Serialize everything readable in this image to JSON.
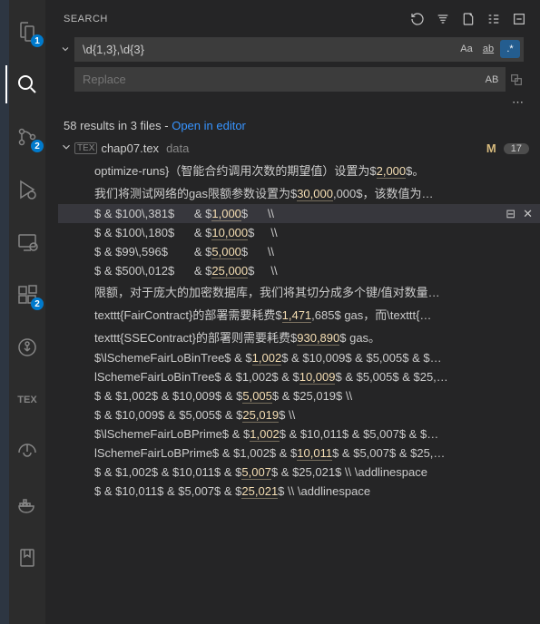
{
  "sidebar_title": "SEARCH",
  "search": {
    "query": "\\d{1,3},\\d{3}",
    "replace_placeholder": "Replace",
    "case_label": "Aa",
    "word_label": "ab",
    "regex_label": ".*",
    "preserve_case_label": "AB"
  },
  "summary": {
    "text": "58 results in 3 files - ",
    "link": "Open in editor"
  },
  "file": {
    "name": "chap07.tex",
    "folder": "data",
    "status": "M",
    "count": "17",
    "icon_label": "TEX"
  },
  "activity_badges": {
    "explorer": "1",
    "scm": "2",
    "ext": "2"
  },
  "lines": [
    {
      "pre": "optimize-runs}（智能合约调用次数的期望值）设置为$",
      "hl": "2,000",
      "post": "$。"
    },
    {
      "pre": "我们将测试网络的gas限额参数设置为$",
      "hl": "30,000",
      "post": ",000$，该数值为…"
    },
    {
      "pre": "$ & $100\\,381$      & $",
      "hl": "1,000",
      "post": "$      \\\\",
      "active": true
    },
    {
      "pre": "$ & $100\\,180$      & $",
      "hl": "10,000",
      "post": "$     \\\\"
    },
    {
      "pre": "$ & $99\\,596$        & $",
      "hl": "5,000",
      "post": "$      \\\\"
    },
    {
      "pre": "$ & $500\\,012$      & $",
      "hl": "25,000",
      "post": "$     \\\\"
    },
    {
      "pre": "限额，对于庞大的加密数据库，我们将其切分成多个键/值对数量…",
      "hl": "",
      "post": ""
    },
    {
      "pre": "texttt{FairContract}的部署需要耗费$",
      "hl": "1,471",
      "post": ",685$ gas，而\\texttt{…"
    },
    {
      "pre": "texttt{SSEContract}的部署则需要耗费$",
      "hl": "930,890",
      "post": "$ gas。"
    },
    {
      "pre": "$\\lSchemeFairLoBinTree$ & $",
      "hl": "1,002",
      "post": "$ & $10,009$ & $5,005$ & $…"
    },
    {
      "pre": "lSchemeFairLoBinTree$ & $1,002$ & $",
      "hl": "10,009",
      "post": "$ & $5,005$ & $25,…"
    },
    {
      "pre": "$ & $1,002$ & $10,009$ & $",
      "hl": "5,005",
      "post": "$ & $25,019$ \\\\"
    },
    {
      "pre": "$ & $10,009$ & $5,005$ & $",
      "hl": "25,019",
      "post": "$ \\\\"
    },
    {
      "pre": "$\\lSchemeFairLoBPrime$  & $",
      "hl": "1,002",
      "post": "$ & $10,011$ & $5,007$ & $…"
    },
    {
      "pre": "lSchemeFairLoBPrime$ & $1,002$ & $",
      "hl": "10,011",
      "post": "$ & $5,007$ & $25,…"
    },
    {
      "pre": "$  & $1,002$ & $10,011$ & $",
      "hl": "5,007",
      "post": "$ & $25,021$ \\\\ \\addlinespace"
    },
    {
      "pre": "$ & $10,011$ & $5,007$ & $",
      "hl": "25,021",
      "post": "$ \\\\ \\addlinespace"
    }
  ]
}
